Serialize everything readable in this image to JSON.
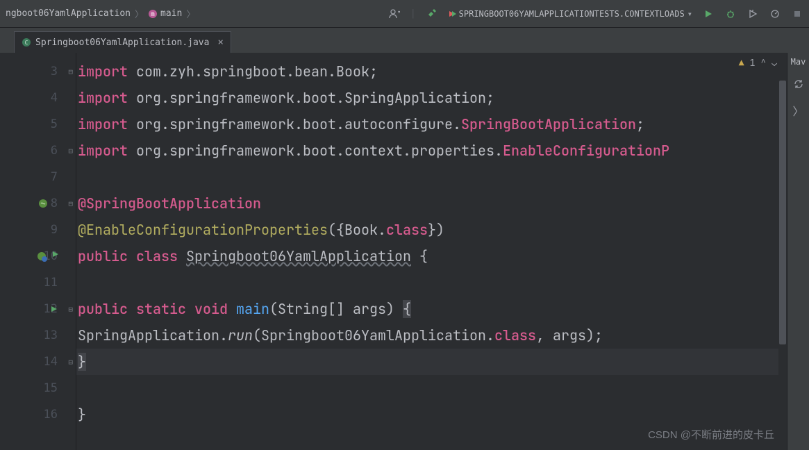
{
  "breadcrumb": {
    "item1": "ngboot06YamlApplication",
    "item2": "main"
  },
  "runConfig": {
    "label": "SPRINGBOOT06YAMLAPPLICATIONTESTS.CONTEXTLOADS"
  },
  "tab": {
    "label": "Springboot06YamlApplication.java"
  },
  "inspection": {
    "warnings": "1"
  },
  "rightPanel": {
    "label": "Mav"
  },
  "code": {
    "lines": [
      {
        "n": "3"
      },
      {
        "n": "4"
      },
      {
        "n": "5"
      },
      {
        "n": "6"
      },
      {
        "n": "7"
      },
      {
        "n": "8"
      },
      {
        "n": "9"
      },
      {
        "n": "10"
      },
      {
        "n": "11"
      },
      {
        "n": "12"
      },
      {
        "n": "13"
      },
      {
        "n": "14"
      },
      {
        "n": "15"
      },
      {
        "n": "16"
      }
    ],
    "l3_import": "import",
    "l3_pkg": " com.zyh.springboot.bean.Book;",
    "l4_import": "import",
    "l4_pkg": " org.springframework.boot.SpringApplication;",
    "l5_import": "import",
    "l5_pkg": " org.springframework.boot.autoconfigure.",
    "l5_cls": "SpringBootApplication",
    "l5_semi": ";",
    "l6_import": "import",
    "l6_pkg": " org.springframework.boot.context.properties.",
    "l6_cls": "EnableConfigurationP",
    "l8_ann": "@SpringBootApplication",
    "l9_ann": "@EnableConfigurationProperties",
    "l9_paren1": "({",
    "l9_bookcls": "Book",
    "l9_dot": ".",
    "l9_class": "class",
    "l9_paren2": "})",
    "l10_public": "public ",
    "l10_class": "class ",
    "l10_name": "Springboot06YamlApplication",
    "l10_brace": " {",
    "l12_public": "public ",
    "l12_static": "static ",
    "l12_void": "void ",
    "l12_main": "main",
    "l12_params": "(String[] args) ",
    "l12_brace": "{",
    "l13_app": "SpringApplication",
    "l13_dot": ".",
    "l13_run": "run",
    "l13_args1": "(Springboot06YamlApplication.",
    "l13_class": "class",
    "l13_args2": ", args);",
    "l14_brace": "}",
    "l16_brace": "}"
  },
  "watermark": "CSDN @不断前进的皮卡丘"
}
